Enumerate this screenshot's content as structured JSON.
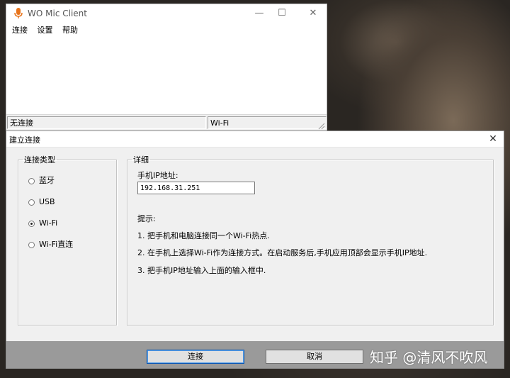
{
  "main_window": {
    "title": "WO Mic Client",
    "controls": {
      "minimize": "—",
      "maximize": "☐",
      "close": "✕"
    },
    "menu": [
      "连接",
      "设置",
      "帮助"
    ],
    "status": {
      "connection": "无连接",
      "transport": "Wi-Fi"
    }
  },
  "dialog": {
    "title": "建立连接",
    "close": "✕",
    "connection_type": {
      "legend": "连接类型",
      "options": [
        {
          "label": "蓝牙",
          "selected": false
        },
        {
          "label": "USB",
          "selected": false
        },
        {
          "label": "Wi-Fi",
          "selected": true
        },
        {
          "label": "Wi-Fi直连",
          "selected": false
        }
      ]
    },
    "details": {
      "legend": "详细",
      "ip_label": "手机IP地址:",
      "ip_value": "192.168.31.251",
      "hint_title": "提示:",
      "hints": [
        "1. 把手机和电脑连接同一个Wi-Fi热点.",
        "2. 在手机上选择Wi-Fi作为连接方式。在启动服务后,手机应用顶部会显示手机IP地址.",
        "3. 把手机IP地址输入上面的输入框中."
      ]
    },
    "buttons": {
      "connect": "连接",
      "cancel": "取消"
    }
  },
  "watermark": "知乎 @清风不吹风",
  "colors": {
    "default_button_border": "#0a58b6",
    "button_bar": "#9a9a9a",
    "dialog_bg": "#f0f0f0"
  }
}
